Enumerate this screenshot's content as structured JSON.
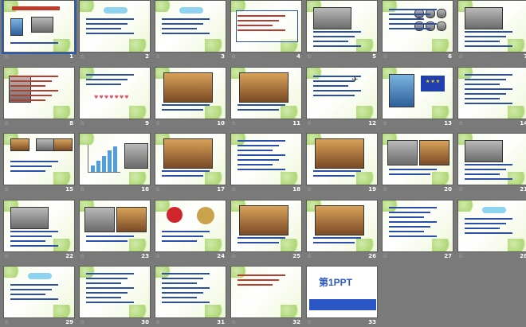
{
  "slides": [
    {
      "n": "1",
      "kind": "title"
    },
    {
      "n": "2",
      "kind": "list"
    },
    {
      "n": "3",
      "kind": "list"
    },
    {
      "n": "4",
      "kind": "box"
    },
    {
      "n": "5",
      "kind": "photo-text"
    },
    {
      "n": "6",
      "kind": "logos"
    },
    {
      "n": "7",
      "kind": "photo-text"
    },
    {
      "n": "8",
      "kind": "portrait"
    },
    {
      "n": "9",
      "kind": "hearts"
    },
    {
      "n": "10",
      "kind": "photo"
    },
    {
      "n": "11",
      "kind": "photo"
    },
    {
      "n": "12",
      "kind": "birds"
    },
    {
      "n": "13",
      "kind": "eu"
    },
    {
      "n": "14",
      "kind": "text"
    },
    {
      "n": "15",
      "kind": "money"
    },
    {
      "n": "16",
      "kind": "chart"
    },
    {
      "n": "17",
      "kind": "photo"
    },
    {
      "n": "18",
      "kind": "text"
    },
    {
      "n": "19",
      "kind": "photo"
    },
    {
      "n": "20",
      "kind": "photos"
    },
    {
      "n": "21",
      "kind": "photo-text"
    },
    {
      "n": "22",
      "kind": "photo-text"
    },
    {
      "n": "23",
      "kind": "photos"
    },
    {
      "n": "24",
      "kind": "olympic"
    },
    {
      "n": "25",
      "kind": "photo"
    },
    {
      "n": "26",
      "kind": "photo"
    },
    {
      "n": "27",
      "kind": "text"
    },
    {
      "n": "28",
      "kind": "list"
    },
    {
      "n": "29",
      "kind": "list"
    },
    {
      "n": "30",
      "kind": "text"
    },
    {
      "n": "31",
      "kind": "text"
    },
    {
      "n": "32",
      "kind": "red"
    },
    {
      "n": "33",
      "kind": "logo"
    }
  ],
  "logo": {
    "brand": "第1PPT"
  },
  "colors": {
    "background": "#7a7a7a",
    "selection": "#2a5db0",
    "title_red": "#c03a2b",
    "text_blue": "#2b4ea8"
  }
}
